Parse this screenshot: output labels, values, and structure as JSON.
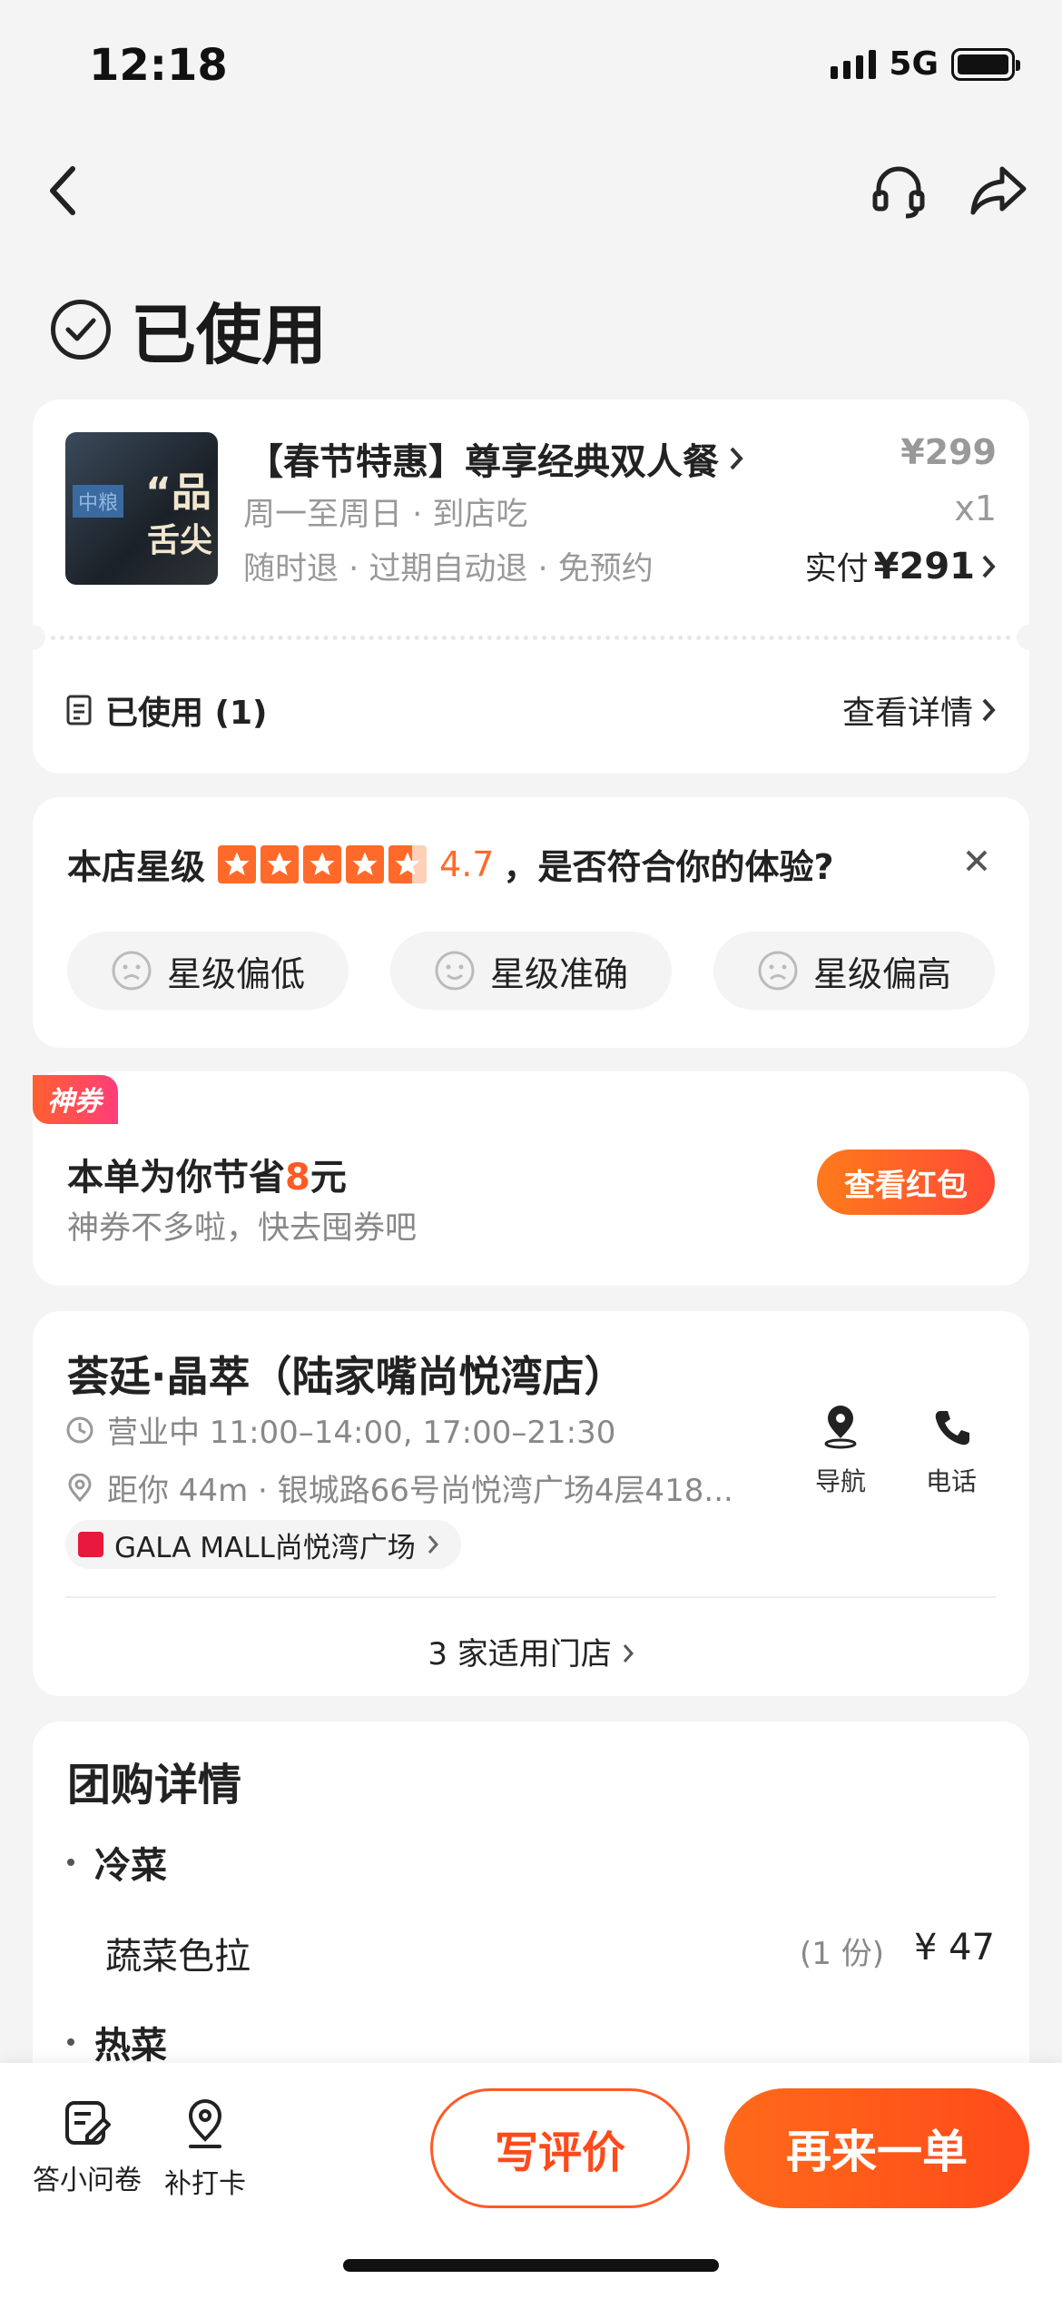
{
  "status_bar": {
    "time": "12:18",
    "network": "5G"
  },
  "page": {
    "status_title": "已使用"
  },
  "order": {
    "title": "【春节特惠】尊享经典双人餐",
    "subtitle1": "周一至周日 · 到店吃",
    "subtitle2": "随时退 · 过期自动退 · 免预约",
    "price": "¥299",
    "quantity": "x1",
    "paid_label": "实付",
    "paid_amount": "¥291",
    "used_label": "已使用 (1)",
    "detail_link": "查看详情",
    "thumb_text1": "“品",
    "thumb_text2": "舌尖",
    "thumb_small": "中粮"
  },
  "rating": {
    "label": "本店星级",
    "score": "4.7",
    "question": "，是否符合你的体验?",
    "stars": 4.7,
    "options": [
      "星级偏低",
      "星级准确",
      "星级偏高"
    ]
  },
  "coupon": {
    "tag": "神券",
    "title_prefix": "本单为你节省",
    "amount": "8",
    "title_suffix": "元",
    "subtitle": "神券不多啦，快去囤券吧",
    "button": "查看红包"
  },
  "store": {
    "name": "荟廷·晶萃（陆家嘴尚悦湾店）",
    "hours": "营业中 11:00–14:00, 17:00–21:30",
    "distance": "距你 44m ·  银城路66号尚悦湾广场4层418...",
    "mall": "GALA MALL尚悦湾广场",
    "nav_label": "导航",
    "phone_label": "电话",
    "stores_link": "3 家适用门店"
  },
  "group": {
    "title": "团购详情",
    "section1": "冷菜",
    "dish1_name": "蔬菜色拉",
    "dish1_qty": "(1 份)",
    "dish1_price": "¥ 47",
    "section2": "热菜"
  },
  "bottom": {
    "survey_label": "答小问卷",
    "checkin_label": "补打卡",
    "review_button": "写评价",
    "reorder_button": "再来一单"
  },
  "colors": {
    "accent": "#ff5a24",
    "background": "#f4f4f4",
    "star": "#ff6a2a"
  }
}
